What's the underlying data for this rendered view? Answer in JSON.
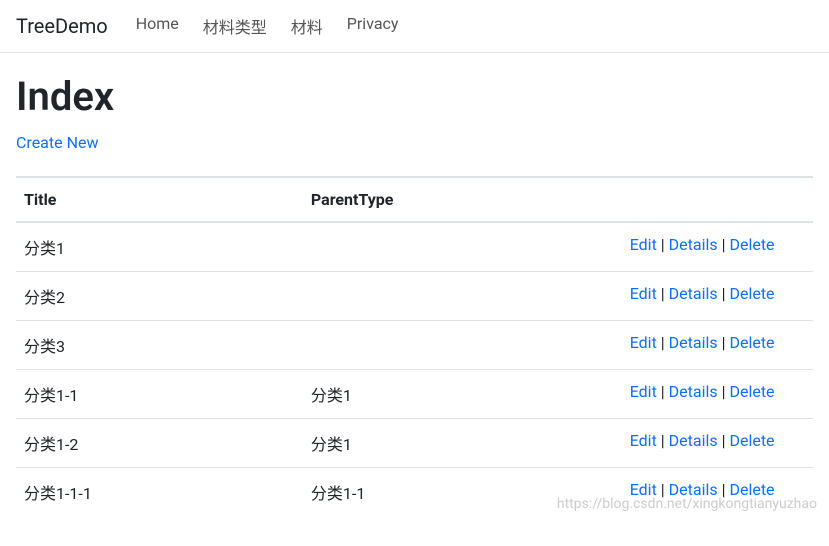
{
  "navbar": {
    "brand": "TreeDemo",
    "links": [
      "Home",
      "材料类型",
      "材料",
      "Privacy"
    ]
  },
  "page": {
    "title": "Index",
    "create_label": "Create New"
  },
  "table": {
    "headers": {
      "title": "Title",
      "parent": "ParentType",
      "actions": ""
    },
    "actions": {
      "edit": "Edit",
      "details": "Details",
      "delete": "Delete",
      "sep": " | "
    },
    "rows": [
      {
        "title": "分类1",
        "parent": ""
      },
      {
        "title": "分类2",
        "parent": ""
      },
      {
        "title": "分类3",
        "parent": ""
      },
      {
        "title": "分类1-1",
        "parent": "分类1"
      },
      {
        "title": "分类1-2",
        "parent": "分类1"
      },
      {
        "title": "分类1-1-1",
        "parent": "分类1-1"
      }
    ]
  },
  "watermark": "https://blog.csdn.net/xingkongtianyuzhao"
}
